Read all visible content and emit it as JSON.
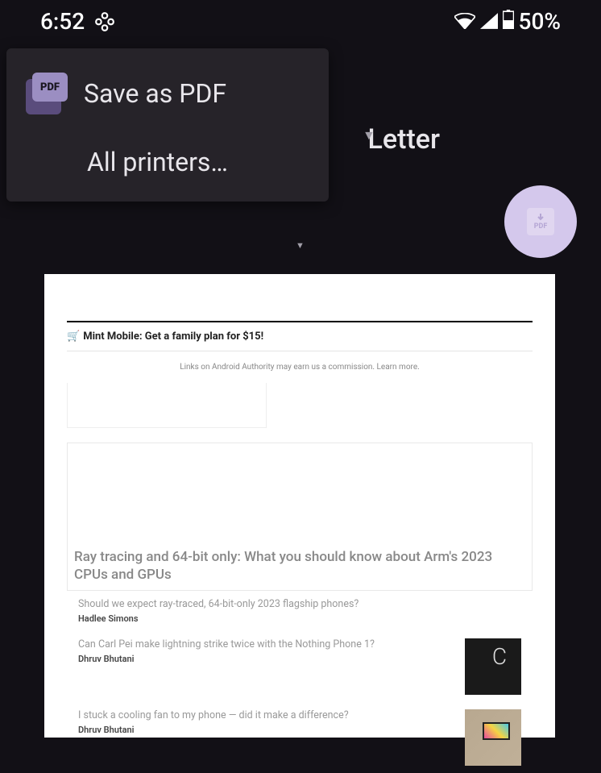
{
  "status_bar": {
    "time": "6:52",
    "battery_text": "50%"
  },
  "print": {
    "paper_size": "Letter"
  },
  "dropdown": {
    "save_pdf": "Save as PDF",
    "pdf_badge": "PDF",
    "all_printers": "All printers…"
  },
  "fab": {
    "label": "PDF"
  },
  "preview": {
    "banner": "Mint Mobile: Get a family plan for $15!",
    "disclosure": "Links on Android Authority may earn us a commission. Learn more.",
    "featured_title": "Ray tracing and 64-bit only: What you should know about Arm's 2023 CPUs and GPUs",
    "articles": [
      {
        "title": "Should we expect ray-traced, 64-bit-only 2023 flagship phones?",
        "author": "Hadlee Simons"
      },
      {
        "title": "Can Carl Pei make lightning strike twice with the Nothing Phone 1?",
        "author": "Dhruv Bhutani"
      },
      {
        "title": "I stuck a cooling fan to my phone — did it make a difference?",
        "author": "Dhruv Bhutani"
      }
    ]
  }
}
